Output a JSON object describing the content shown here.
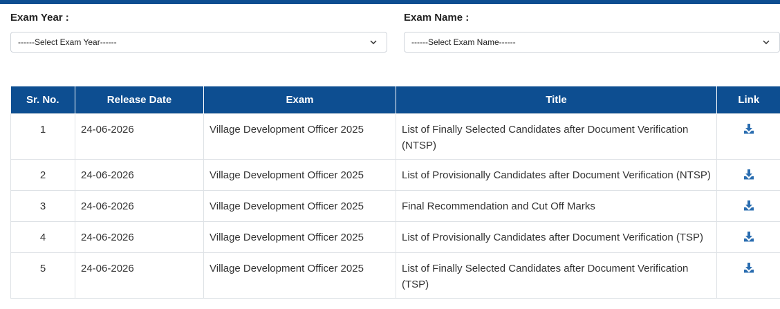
{
  "filters": {
    "exam_year_label": "Exam Year :",
    "exam_year_value": "------Select Exam Year------",
    "exam_name_label": "Exam Name :",
    "exam_name_value": "------Select Exam Name------"
  },
  "table": {
    "headers": [
      "Sr. No.",
      "Release Date",
      "Exam",
      "Title",
      "Link"
    ],
    "rows": [
      {
        "sr": "1",
        "date": "24-06-2026",
        "exam": "Village Development Officer 2025",
        "title": "List of Finally Selected Candidates after Document Verification (NTSP)"
      },
      {
        "sr": "2",
        "date": "24-06-2026",
        "exam": "Village Development Officer 2025",
        "title": "List of Provisionally Candidates after Document Verification (NTSP)"
      },
      {
        "sr": "3",
        "date": "24-06-2026",
        "exam": "Village Development Officer 2025",
        "title": "Final Recommendation and Cut Off Marks"
      },
      {
        "sr": "4",
        "date": "24-06-2026",
        "exam": "Village Development Officer 2025",
        "title": "List of Provisionally Candidates after Document Verification (TSP)"
      },
      {
        "sr": "5",
        "date": "24-06-2026",
        "exam": "Village Development Officer 2025",
        "title": "List of Finally Selected Candidates after Document Verification (TSP)"
      }
    ],
    "link_icon": "download-icon"
  },
  "colors": {
    "header_bg": "#0d4e91",
    "icon": "#2a6db0"
  }
}
